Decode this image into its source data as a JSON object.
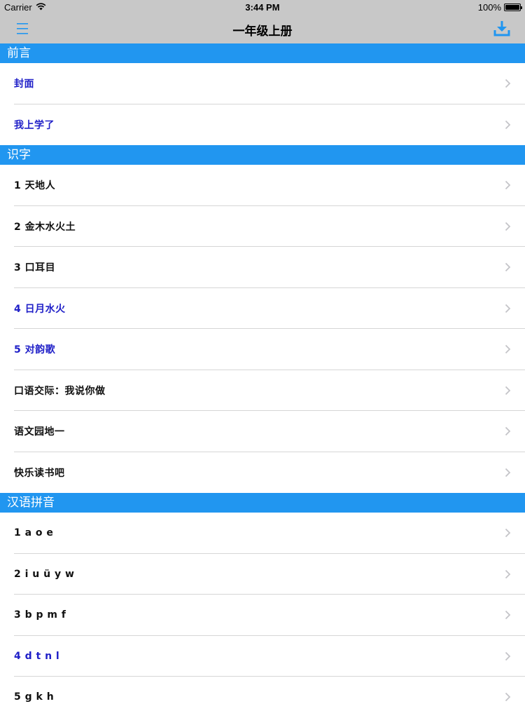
{
  "status_bar": {
    "carrier": "Carrier",
    "time": "3:44 PM",
    "battery": "100%",
    "battery_level": 1.0
  },
  "nav": {
    "title": "一年级上册",
    "menu_icon": "hamburger-menu-icon",
    "download_icon": "download-icon",
    "accent_color": "#2196f0"
  },
  "colors": {
    "section_header_bg": "#2196f0",
    "section_header_text": "#ffffff",
    "item_default": "#111111",
    "item_highlight": "#2020c8",
    "chevron": "#c4c4c8"
  },
  "sections": [
    {
      "title": "前言",
      "items": [
        {
          "label": "封面",
          "highlighted": true
        },
        {
          "label": "我上学了",
          "highlighted": true
        }
      ]
    },
    {
      "title": "识字",
      "items": [
        {
          "label": "1 天地人",
          "highlighted": false
        },
        {
          "label": "2 金木水火土",
          "highlighted": false
        },
        {
          "label": "3 口耳目",
          "highlighted": false
        },
        {
          "label": "4 日月水火",
          "highlighted": true
        },
        {
          "label": "5 对韵歌",
          "highlighted": true
        },
        {
          "label": "口语交际：我说你做",
          "highlighted": false
        },
        {
          "label": "语文园地一",
          "highlighted": false
        },
        {
          "label": "快乐读书吧",
          "highlighted": false
        }
      ]
    },
    {
      "title": "汉语拼音",
      "items": [
        {
          "label": "1 a o e",
          "highlighted": false
        },
        {
          "label": "2 i u ü y w",
          "highlighted": false
        },
        {
          "label": "3 b p m f",
          "highlighted": false
        },
        {
          "label": "4 d t n l",
          "highlighted": true
        },
        {
          "label": "5 g k h",
          "highlighted": false
        }
      ]
    }
  ]
}
